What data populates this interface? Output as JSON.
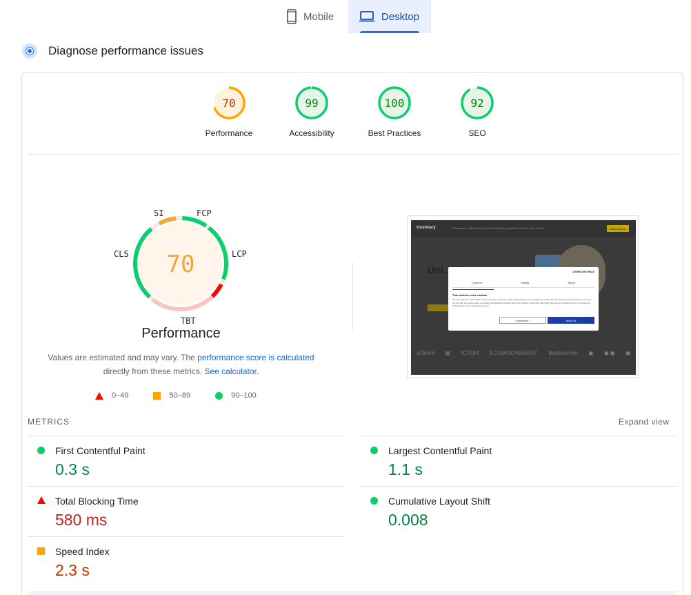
{
  "tabs": {
    "mobile": "Mobile",
    "desktop": "Desktop"
  },
  "diagnose": {
    "title": "Diagnose performance issues"
  },
  "scores": [
    {
      "value": "70",
      "label": "Performance",
      "fraction": 0.7,
      "color": "#ffa400",
      "bg": "#fff3e0",
      "text_color": "#c33300"
    },
    {
      "value": "99",
      "label": "Accessibility",
      "fraction": 0.99,
      "color": "#0cce6b",
      "bg": "#e6f4ea",
      "text_color": "#008800"
    },
    {
      "value": "100",
      "label": "Best Practices",
      "fraction": 1.0,
      "color": "#0cce6b",
      "bg": "#e6f4ea",
      "text_color": "#008800"
    },
    {
      "value": "92",
      "label": "SEO",
      "fraction": 0.92,
      "color": "#0cce6b",
      "bg": "#e6f4ea",
      "text_color": "#008800"
    }
  ],
  "main_gauge": {
    "score": "70",
    "title": "Performance",
    "labels": {
      "si": "SI",
      "fcp": "FCP",
      "lcp": "LCP",
      "tbt": "TBT",
      "cls": "CLS"
    }
  },
  "note": {
    "text1": "Values are estimated and may vary. The ",
    "link1": "performance score is calculated",
    "text2": "directly from these metrics.",
    "link2": "See calculator."
  },
  "legend": {
    "fail": "0–49",
    "average": "50–89",
    "pass": "90–100"
  },
  "screenshot": {
    "logo": "trustmary",
    "nav": "Features ▾   Solutions ▾   Pricing   Resources ▾   Free trial client",
    "nav_button": "Book a demo",
    "hero": "Unl... of r...",
    "modal": {
      "brand": "USERCENTRICS",
      "tabs": [
        "Consent",
        "Details",
        "About"
      ],
      "heading": "This website uses cookies",
      "text": "We use cookies to personalise content and ads, to provide social media features and to analyse our traffic. We also share information about your use of our site with our social media, advertising and analytics partners who may combine it with other information that you've provided to them or that they've collected from your use of their services.",
      "btn_customize": "Customize  ›",
      "btn_allow": "Allow all"
    },
    "logos": [
      "aTalent",
      "▦",
      "ICTUM",
      "EDUMOOVEMENT",
      "Barbiesmes",
      "◼",
      "◼ ◼",
      "◼"
    ]
  },
  "metrics": {
    "header": "METRICS",
    "expand": "Expand view",
    "items": [
      {
        "name": "First Contentful Paint",
        "value": "0.3 s",
        "rating": "pass"
      },
      {
        "name": "Largest Contentful Paint",
        "value": "1.1 s",
        "rating": "pass"
      },
      {
        "name": "Total Blocking Time",
        "value": "580 ms",
        "rating": "fail"
      },
      {
        "name": "Cumulative Layout Shift",
        "value": "0.008",
        "rating": "pass"
      },
      {
        "name": "Speed Index",
        "value": "2.3 s",
        "rating": "average"
      }
    ]
  }
}
